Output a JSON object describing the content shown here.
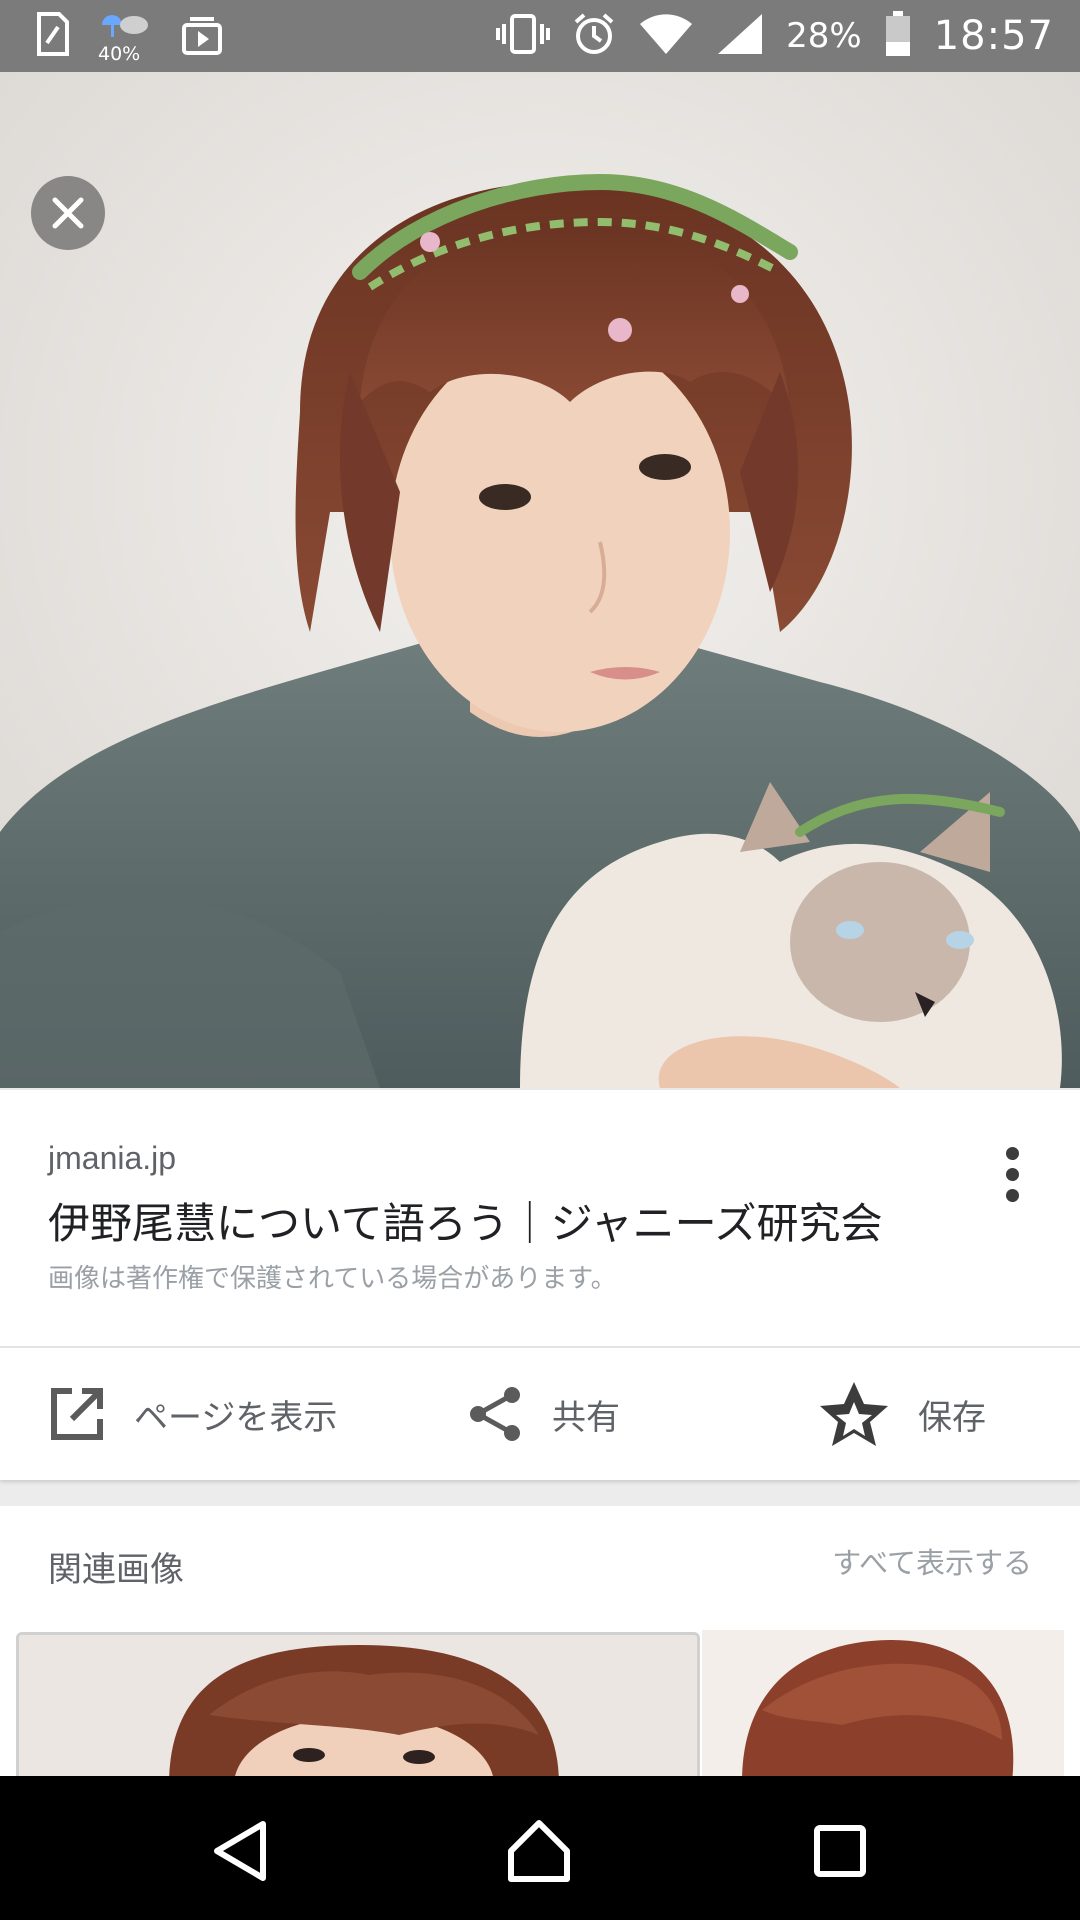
{
  "status_bar": {
    "weather_percent": "40%",
    "battery_percent": "28%",
    "time": "18:57",
    "icons": [
      "sim-icon",
      "weather-icon",
      "video-icon",
      "vibrate-icon",
      "alarm-icon",
      "wifi-icon",
      "signal-icon",
      "battery-icon"
    ]
  },
  "viewer": {
    "close_icon": "close-icon"
  },
  "result": {
    "domain": "jmania.jp",
    "title": "伊野尾慧について語ろう｜ジャニーズ研究会",
    "copyright_notice": "画像は著作権で保護されている場合があります。",
    "more_icon": "more-vert-icon"
  },
  "actions": [
    {
      "label": "ページを表示",
      "icon": "open-in-new-icon"
    },
    {
      "label": "共有",
      "icon": "share-icon"
    },
    {
      "label": "保存",
      "icon": "star-icon"
    }
  ],
  "related": {
    "title": "関連画像",
    "view_all": "すべて表示する"
  },
  "navigation": {
    "icons": [
      "back-icon",
      "home-icon",
      "recents-icon"
    ]
  }
}
